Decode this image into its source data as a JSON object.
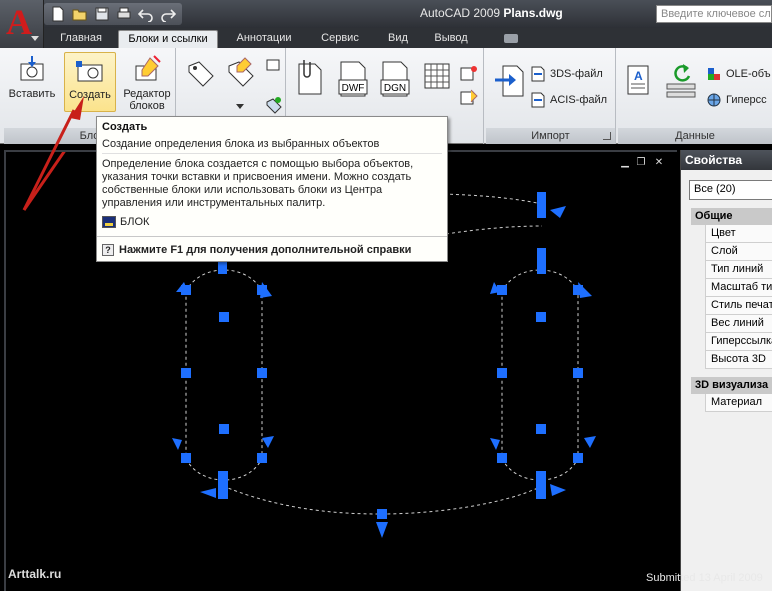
{
  "app": {
    "title_prefix": "AutoCAD 2009",
    "title_file": "Plans.dwg",
    "search_placeholder": "Введите ключевое сло"
  },
  "quick_access_icons": [
    "new-icon",
    "open-icon",
    "save-icon",
    "print-icon",
    "undo-icon",
    "redo-icon"
  ],
  "tabs": [
    {
      "label": "Главная",
      "active": false
    },
    {
      "label": "Блоки и ссылки",
      "active": true
    },
    {
      "label": "Аннотации",
      "active": false
    },
    {
      "label": "Сервис",
      "active": false
    },
    {
      "label": "Вид",
      "active": false
    },
    {
      "label": "Вывод",
      "active": false
    }
  ],
  "ribbon": {
    "block_panel": {
      "title": "Бло",
      "insert_label": "Вставить",
      "create_label": "Создать",
      "editor_label_1": "Редактор",
      "editor_label_2": "блоков"
    },
    "import_panel": {
      "title": "Импорт",
      "format_3ds": "3DS-файл",
      "format_acis": "ACIS-файл"
    },
    "data_panel": {
      "title": "Данные",
      "ole": "OLE-объ",
      "hyperlink": "Гиперсс"
    },
    "attach_labels": [
      "DWF",
      "DGN"
    ]
  },
  "tooltip": {
    "title": "Создать",
    "subtitle": "Создание определения блока из выбранных объектов",
    "description": "Определение блока создается с помощью выбора объектов, указания точки вставки и присвоения имени. Можно создать собственные блоки или использовать блоки из Центра управления или инструментальных палитр.",
    "command": "БЛОК",
    "help": "Нажмите F1 для получения дополнительной справки"
  },
  "properties": {
    "header": "Свойства",
    "selection": "Все (20)",
    "groups": [
      {
        "title": "Общие",
        "items": [
          "Цвет",
          "Слой",
          "Тип линий",
          "Масштаб ти",
          "Стиль печат",
          "Вес линий",
          "Гиперссылка",
          "Высота 3D"
        ]
      },
      {
        "title": "3D визуализа",
        "items": [
          "Материал"
        ]
      }
    ]
  },
  "colors": {
    "grip": "#1e6fff",
    "arrow": "#c8201a",
    "title_bar": "#2d3036"
  },
  "watermark": "Arttalk.ru",
  "submitted": "Submitted 13 April 2009"
}
